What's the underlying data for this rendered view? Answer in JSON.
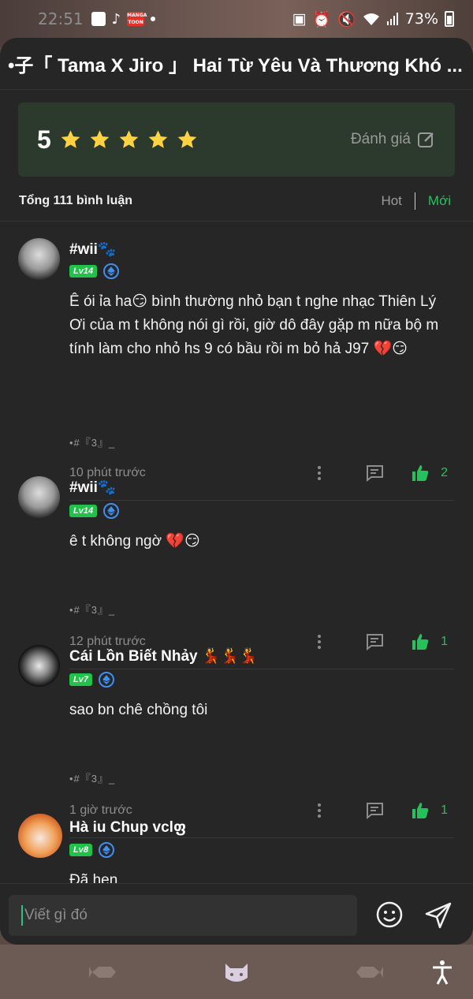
{
  "status_bar": {
    "time": "22:51",
    "manga_badge": "MANGA TOON",
    "battery": "73%",
    "icons": [
      "gallery-icon",
      "tiktok-icon",
      "mangatoon-icon",
      "dot-icon",
      "alarm-icon",
      "mute-icon",
      "wifi-icon",
      "signal-icon",
      "battery-icon"
    ]
  },
  "sheet": {
    "title": "•⼦「 Tama X Jiro 」 Hai Từ Yêu Và Thương Khó ..."
  },
  "rating": {
    "score": "5",
    "stars": 5,
    "rate_label": "Đánh giá"
  },
  "comments_header": {
    "total": "Tổng 111 bình luận",
    "sort_hot": "Hot",
    "sort_new": "Mới"
  },
  "comments": [
    {
      "user": "#wii🐾",
      "level": "Lv14",
      "text": "Ê ói ỉa ha😏 bình thường nhỏ bạn t nghe nhạc Thiên Lý Ơi của m t không nói gì rồi, giờ dô đây gặp m nữa bộ m tính làm cho nhỏ hs 9 có bầu rồi m bỏ hả J97 💔😏",
      "tag": "•#『3』_",
      "time": "10 phút trước",
      "likes": "2"
    },
    {
      "user": "#wii🐾",
      "level": "Lv14",
      "text": "ê t không ngờ 💔😏",
      "tag": "•#『3』_",
      "time": "12 phút trước",
      "likes": "1"
    },
    {
      "user": "Cái Lồn Biết Nhảy 💃💃💃",
      "level": "Lv7",
      "text": "sao bn chê chồng tôi",
      "tag": "•#『3』_",
      "time": "1 giờ trước",
      "likes": "1"
    },
    {
      "user": "Hà iu Chup vclფ",
      "level": "Lv8",
      "text": "Đã hẹn",
      "tag": "",
      "time": "",
      "likes": ""
    }
  ],
  "composer": {
    "placeholder": "Viết gì đó"
  },
  "nav": {
    "icons": [
      "fish-icon",
      "cat-face-icon",
      "fish-icon",
      "accessibility-icon"
    ]
  },
  "colors": {
    "accent_green": "#25c25c",
    "star_yellow": "#ffd23f",
    "sheet_bg": "#262626",
    "rating_bg": "#2b3a2c"
  }
}
